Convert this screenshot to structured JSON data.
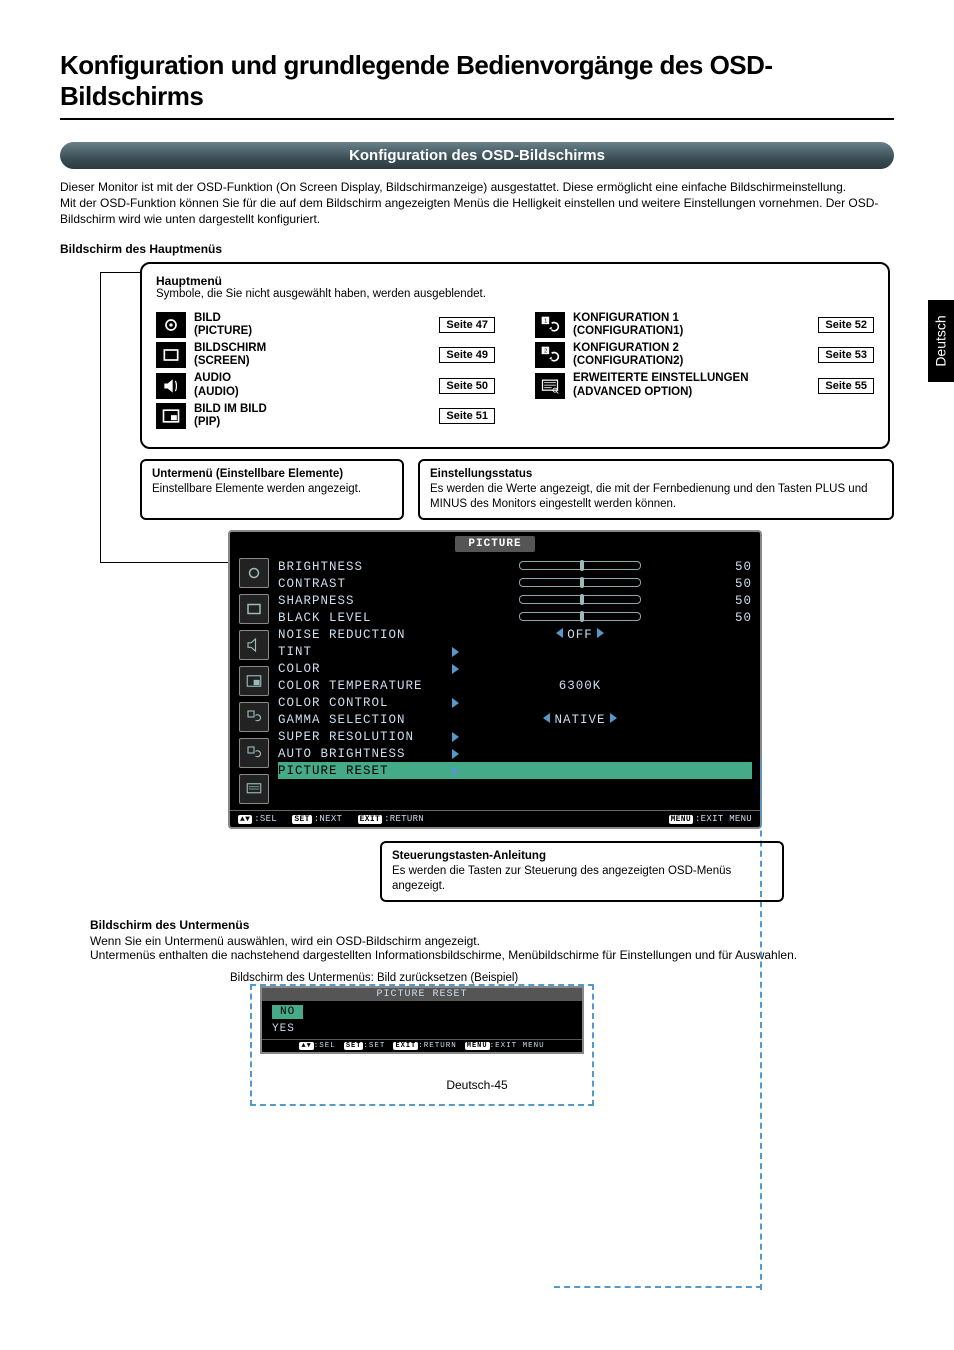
{
  "language_tab": "Deutsch",
  "h1": "Konfiguration und grundlegende Bedienvorgänge des OSD-Bildschirms",
  "section_title": "Konfiguration des OSD-Bildschirms",
  "intro_p1": "Dieser Monitor ist mit der OSD-Funktion (On Screen Display, Bildschirmanzeige) ausgestattet. Diese ermöglicht eine einfache Bildschirmeinstellung.",
  "intro_p2": "Mit der OSD-Funktion können Sie für die auf dem Bildschirm angezeigten Menüs die Helligkeit einstellen und weitere Einstellungen vornehmen. Der OSD-Bildschirm wird wie unten dargestellt konfiguriert.",
  "main_menu_heading": "Bildschirm des Hauptmenüs",
  "main_box": {
    "title": "Hauptmenü",
    "subtitle": "Symbole, die Sie nicht ausgewählt haben, werden ausgeblendet.",
    "left": [
      {
        "l1": "BILD",
        "l2": "(PICTURE)",
        "page": "Seite 47"
      },
      {
        "l1": "BILDSCHIRM",
        "l2": "(SCREEN)",
        "page": "Seite 49"
      },
      {
        "l1": "AUDIO",
        "l2": "(AUDIO)",
        "page": "Seite 50"
      },
      {
        "l1": "BILD IM BILD",
        "l2": "(PIP)",
        "page": "Seite 51"
      }
    ],
    "right": [
      {
        "l1": "KONFIGURATION 1",
        "l2": "(CONFIGURATION1)",
        "page": "Seite 52"
      },
      {
        "l1": "KONFIGURATION 2",
        "l2": "(CONFIGURATION2)",
        "page": "Seite 53"
      },
      {
        "l1": "ERWEITERTE EINSTELLUNGEN",
        "l2": "(ADVANCED OPTION)",
        "page": "Seite 55"
      }
    ]
  },
  "desc_a": {
    "title": "Untermenü (Einstellbare Elemente)",
    "body": "Einstellbare Elemente werden angezeigt."
  },
  "desc_b": {
    "title": "Einstellungsstatus",
    "body": "Es werden die Werte angezeigt, die mit der Fernbedienung und den Tasten PLUS und MINUS des Monitors eingestellt werden können."
  },
  "osd": {
    "title": "PICTURE",
    "rows": [
      {
        "name": "BRIGHTNESS",
        "type": "slider",
        "num": "50"
      },
      {
        "name": "CONTRAST",
        "type": "slider",
        "num": "50"
      },
      {
        "name": "SHARPNESS",
        "type": "slider",
        "num": "50"
      },
      {
        "name": "BLACK LEVEL",
        "type": "slider",
        "num": "50"
      },
      {
        "name": "NOISE REDUCTION",
        "type": "choice",
        "val": "OFF"
      },
      {
        "name": "TINT",
        "type": "sub"
      },
      {
        "name": "COLOR",
        "type": "sub"
      },
      {
        "name": "COLOR TEMPERATURE",
        "type": "text",
        "val": "6300K"
      },
      {
        "name": "COLOR CONTROL",
        "type": "sub"
      },
      {
        "name": "GAMMA SELECTION",
        "type": "choice",
        "val": "NATIVE"
      },
      {
        "name": "SUPER RESOLUTION",
        "type": "sub"
      },
      {
        "name": "AUTO BRIGHTNESS",
        "type": "sub"
      },
      {
        "name": "PICTURE RESET",
        "type": "sub",
        "sel": true
      }
    ],
    "foot": {
      "sel": ":SEL",
      "next": ":NEXT",
      "ret": ":RETURN",
      "exit": ":EXIT MENU",
      "k1": "▲▼",
      "k2": "SET",
      "k3": "EXIT",
      "k4": "MENU"
    }
  },
  "ctrl_box": {
    "title": "Steuerungstasten-Anleitung",
    "body": "Es werden die Tasten zur Steuerung des angezeigten OSD-Menüs angezeigt."
  },
  "submenu_section": {
    "heading": "Bildschirm des Untermenüs",
    "p1": "Wenn Sie ein Untermenü auswählen, wird ein OSD-Bildschirm angezeigt.",
    "p2": "Untermenüs enthalten die nachstehend dargestellten Informationsbildschirme, Menübildschirme für Einstellungen und für Auswahlen.",
    "caption": "Bildschirm des Untermenüs: Bild zurücksetzen (Beispiel)"
  },
  "sub_screen": {
    "title": "PICTURE RESET",
    "opt_no": "NO",
    "opt_yes": "YES",
    "foot": {
      "sel": ":SEL",
      "set": ":SET",
      "ret": ":RETURN",
      "exit": ":EXIT MENU",
      "k1": "▲▼",
      "k2": "SET",
      "k3": "EXIT",
      "k4": "MENU"
    }
  },
  "footer": "Deutsch-45"
}
